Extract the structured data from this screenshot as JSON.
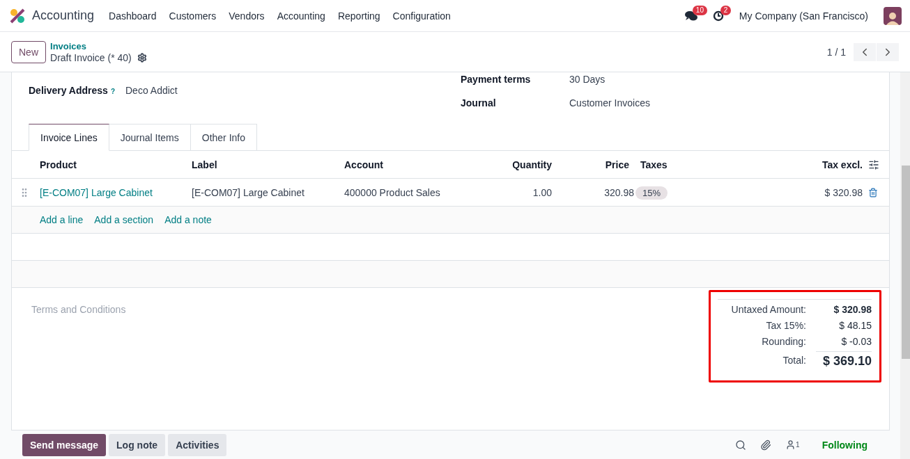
{
  "app": {
    "name": "Accounting"
  },
  "menu": [
    "Dashboard",
    "Customers",
    "Vendors",
    "Accounting",
    "Reporting",
    "Configuration"
  ],
  "systray": {
    "messages_count": "10",
    "activities_count": "2",
    "company": "My Company (San Francisco)"
  },
  "control_panel": {
    "new_button": "New",
    "breadcrumb": "Invoices",
    "record_title": "Draft Invoice (* 40)",
    "pager": "1 / 1"
  },
  "fields_left": [
    {
      "label": "Delivery Address",
      "help": "?",
      "value": "Deco Addict"
    }
  ],
  "fields_right": [
    {
      "label": "Payment terms",
      "value": "30 Days"
    },
    {
      "label": "Journal",
      "value": "Customer Invoices"
    }
  ],
  "tabs": [
    {
      "label": "Invoice Lines",
      "selected": true
    },
    {
      "label": "Journal Items",
      "selected": false
    },
    {
      "label": "Other Info",
      "selected": false
    }
  ],
  "table": {
    "columns": [
      {
        "label": "Product",
        "kind": "text"
      },
      {
        "label": "Label",
        "kind": "text"
      },
      {
        "label": "Account",
        "kind": "text"
      },
      {
        "label": "Quantity",
        "kind": "number"
      },
      {
        "label": "Price",
        "kind": "number"
      },
      {
        "label": "Taxes",
        "kind": "text"
      },
      {
        "label": "Tax excl.",
        "kind": "number"
      }
    ],
    "rows": [
      {
        "product": "[E-COM07] Large Cabinet",
        "label": "[E-COM07] Large Cabinet",
        "account": "400000 Product Sales",
        "quantity": "1.00",
        "price": "320.98",
        "taxes": [
          "15%"
        ],
        "tax_excl": "$ 320.98"
      }
    ],
    "add_links": [
      "Add a line",
      "Add a section",
      "Add a note"
    ]
  },
  "terms_placeholder": "Terms and Conditions",
  "totals": [
    {
      "kind": "subtotal",
      "label": "Untaxed Amount:",
      "value": "$ 320.98"
    },
    {
      "kind": "line",
      "label": "Tax 15%:",
      "value": "$ 48.15"
    },
    {
      "kind": "line",
      "label": "Rounding:",
      "value": "$ -0.03"
    },
    {
      "kind": "total",
      "label": "Total:",
      "value": "$ 369.10"
    }
  ],
  "chatter": {
    "buttons": [
      {
        "label": "Send message",
        "kind": "primary"
      },
      {
        "label": "Log note",
        "kind": "secondary"
      },
      {
        "label": "Activities",
        "kind": "secondary"
      }
    ],
    "followers_count": "1",
    "follow_status": "Following"
  }
}
